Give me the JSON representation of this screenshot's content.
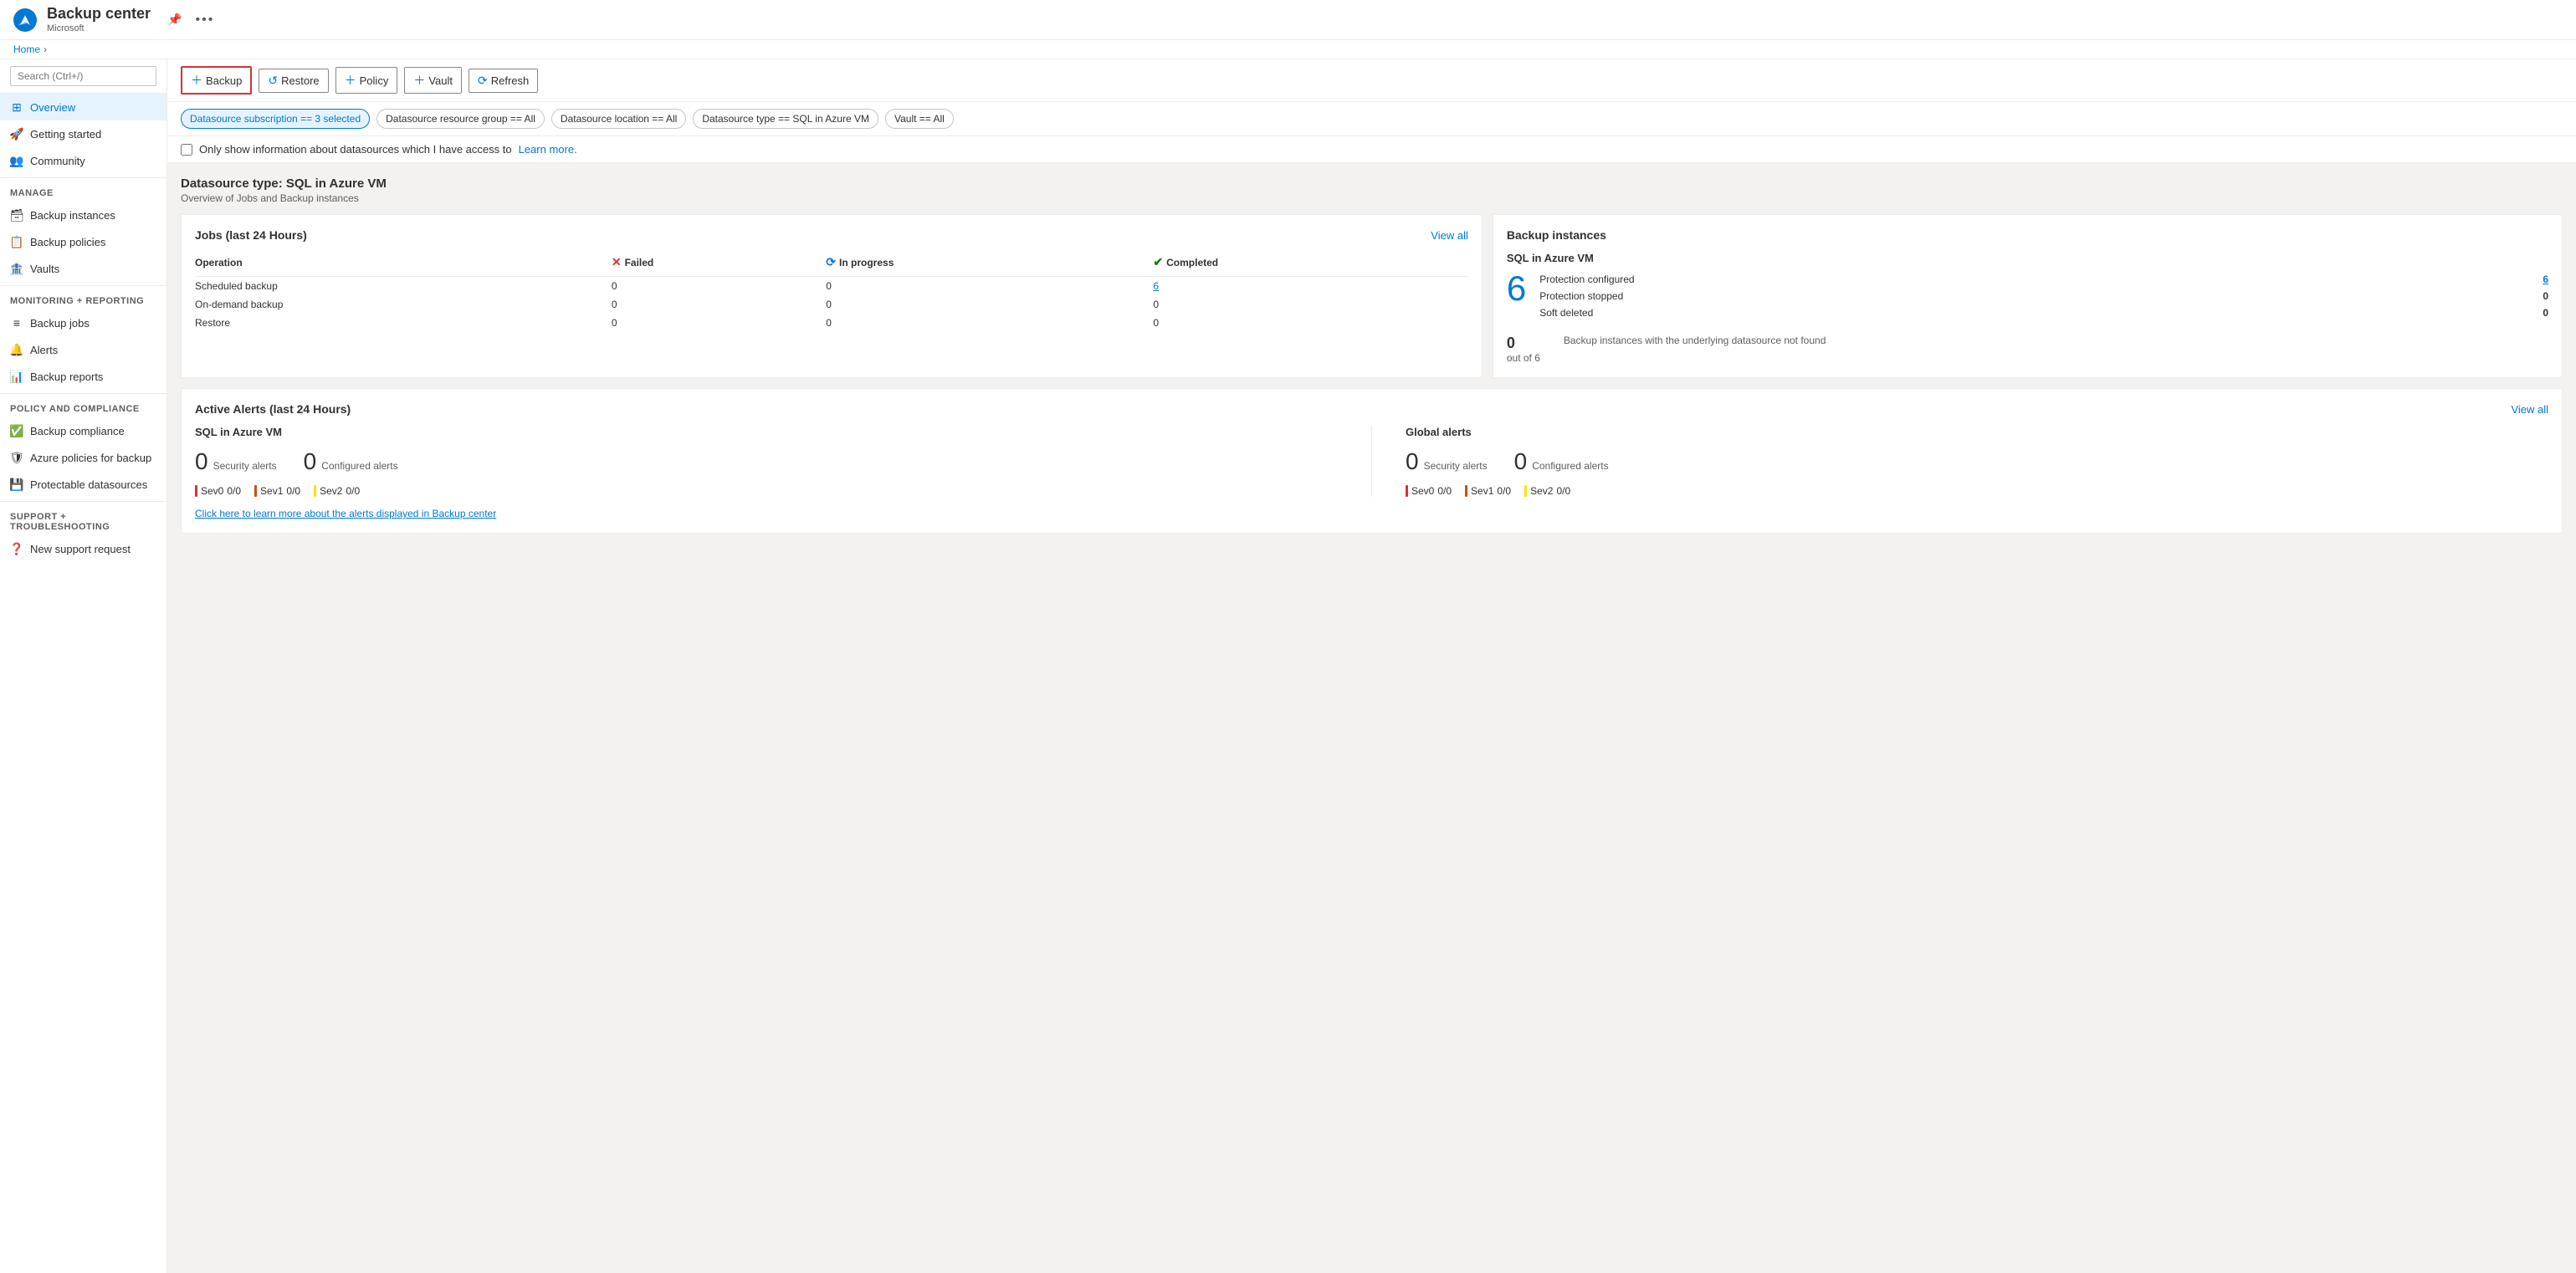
{
  "app": {
    "title": "Backup center",
    "subtitle": "Microsoft",
    "breadcrumb_home": "Home"
  },
  "toolbar": {
    "backup_label": "Backup",
    "restore_label": "Restore",
    "policy_label": "Policy",
    "vault_label": "Vault",
    "refresh_label": "Refresh"
  },
  "filters": [
    {
      "id": "subscription",
      "label": "Datasource subscription == 3 selected",
      "active": true
    },
    {
      "id": "resource_group",
      "label": "Datasource resource group == All",
      "active": false
    },
    {
      "id": "location",
      "label": "Datasource location == All",
      "active": false
    },
    {
      "id": "type",
      "label": "Datasource type == SQL in Azure VM",
      "active": false
    },
    {
      "id": "vault",
      "label": "Vault == All",
      "active": false
    }
  ],
  "checkbox": {
    "label": "Only show information about datasources which I have access to",
    "learn_more": "Learn more."
  },
  "datasource": {
    "title": "Datasource type: SQL in Azure VM",
    "subtitle": "Overview of Jobs and Backup instances"
  },
  "jobs_card": {
    "title": "Jobs (last 24 Hours)",
    "view_all": "View all",
    "headers": [
      "Operation",
      "Failed",
      "In progress",
      "Completed"
    ],
    "rows": [
      {
        "operation": "Scheduled backup",
        "failed": "0",
        "in_progress": "0",
        "completed": "6"
      },
      {
        "operation": "On-demand backup",
        "failed": "0",
        "in_progress": "0",
        "completed": "0"
      },
      {
        "operation": "Restore",
        "failed": "0",
        "in_progress": "0",
        "completed": "0"
      }
    ]
  },
  "backup_instances_card": {
    "title": "Backup instances",
    "section_label": "SQL in Azure VM",
    "big_number": "6",
    "rows": [
      {
        "label": "Protection configured",
        "value": "6",
        "is_link": true
      },
      {
        "label": "Protection stopped",
        "value": "0",
        "is_link": false
      },
      {
        "label": "Soft deleted",
        "value": "0",
        "is_link": false
      }
    ],
    "footer_num": "0",
    "footer_out_of": "out of 6",
    "footer_text": "Backup instances with the underlying datasource not found"
  },
  "alerts_card": {
    "title": "Active Alerts (last 24 Hours)",
    "view_all": "View all",
    "sql_section": {
      "title": "SQL in Azure VM",
      "security_count": "0",
      "security_label": "Security alerts",
      "configured_count": "0",
      "configured_label": "Configured alerts",
      "sev0": "0/0",
      "sev1": "0/0",
      "sev2": "0/0"
    },
    "global_section": {
      "title": "Global alerts",
      "security_count": "0",
      "security_label": "Security alerts",
      "configured_count": "0",
      "configured_label": "Configured alerts",
      "sev0": "0/0",
      "sev1": "0/0",
      "sev2": "0/0"
    },
    "learn_more_text": "Click here to learn more about the alerts displayed in Backup center"
  },
  "sidebar": {
    "search_placeholder": "Search (Ctrl+/)",
    "nav": [
      {
        "id": "overview",
        "label": "Overview",
        "icon": "⊞",
        "active": true,
        "section": null
      },
      {
        "id": "getting-started",
        "label": "Getting started",
        "icon": "🚀",
        "active": false,
        "section": null
      },
      {
        "id": "community",
        "label": "Community",
        "icon": "👥",
        "active": false,
        "section": null
      },
      {
        "id": "manage-label",
        "label": "Manage",
        "is_section": true
      },
      {
        "id": "backup-instances",
        "label": "Backup instances",
        "icon": "🗃",
        "active": false,
        "section": "Manage"
      },
      {
        "id": "backup-policies",
        "label": "Backup policies",
        "icon": "📋",
        "active": false,
        "section": "Manage"
      },
      {
        "id": "vaults",
        "label": "Vaults",
        "icon": "🏦",
        "active": false,
        "section": "Manage"
      },
      {
        "id": "monitoring-label",
        "label": "Monitoring + reporting",
        "is_section": true
      },
      {
        "id": "backup-jobs",
        "label": "Backup jobs",
        "icon": "≡",
        "active": false,
        "section": "Monitoring"
      },
      {
        "id": "alerts",
        "label": "Alerts",
        "icon": "🔔",
        "active": false,
        "section": "Monitoring"
      },
      {
        "id": "backup-reports",
        "label": "Backup reports",
        "icon": "📊",
        "active": false,
        "section": "Monitoring"
      },
      {
        "id": "policy-label",
        "label": "Policy and compliance",
        "is_section": true
      },
      {
        "id": "backup-compliance",
        "label": "Backup compliance",
        "icon": "✅",
        "active": false,
        "section": "Policy"
      },
      {
        "id": "azure-policies",
        "label": "Azure policies for backup",
        "icon": "🛡",
        "active": false,
        "section": "Policy"
      },
      {
        "id": "protectable-datasources",
        "label": "Protectable datasources",
        "icon": "💾",
        "active": false,
        "section": "Policy"
      },
      {
        "id": "support-label",
        "label": "Support + troubleshooting",
        "is_section": true
      },
      {
        "id": "new-support",
        "label": "New support request",
        "icon": "❓",
        "active": false,
        "section": "Support"
      }
    ]
  }
}
